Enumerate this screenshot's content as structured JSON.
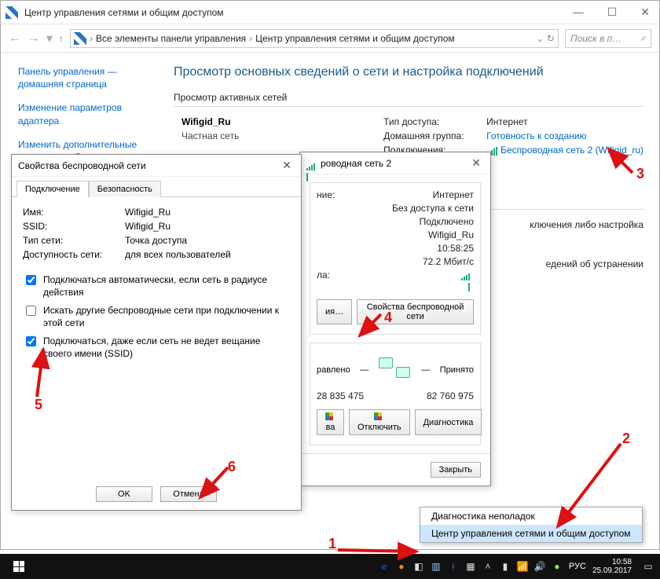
{
  "window": {
    "title": "Центр управления сетями и общим доступом",
    "breadcrumb": {
      "parent": "Все элементы панели управления",
      "current": "Центр управления сетями и общим доступом"
    },
    "search_placeholder": "Поиск в п…"
  },
  "sidebar": {
    "home": "Панель управления — домашняя страница",
    "adapter": "Изменение параметров адаптера",
    "sharing": "Изменить дополнительные параметры общего доступа"
  },
  "main": {
    "header": "Просмотр основных сведений о сети и настройка подключений",
    "active_label": "Просмотр активных сетей",
    "network_name": "Wifigid_Ru",
    "network_type": "Частная сеть",
    "access_type_k": "Тип доступа:",
    "access_type_v": "Интернет",
    "homegroup_k": "Домашняя группа:",
    "homegroup_v": "Готовность к созданию",
    "connections_k": "Подключения:",
    "connections_v": "Беспроводная сеть 2 (Wifigid_ru)",
    "extra1": "ключения либо настройка",
    "extra2": "едений об устранении"
  },
  "status": {
    "title": "роводная сеть 2",
    "section": "ние:",
    "iptype_v": "Интернет",
    "ip6_v": "Без доступа к сети",
    "state_v": "Подключено",
    "ssid_v": "Wifigid_Ru",
    "dur_v": "10:58:25",
    "speed_v": "72.2 Мбит/с",
    "sig_k": "ла:",
    "details_btn": "ия…",
    "props_btn": "Свойства беспроводной сети",
    "activity_k": "равлено",
    "activity_r": "Принято",
    "sent": "28 835 475",
    "recv": "82 760 975",
    "props2": "ва",
    "disable": "Отключить",
    "diag": "Диагностика",
    "close": "Закрыть"
  },
  "props": {
    "title": "Свойства беспроводной сети",
    "tab1": "Подключение",
    "tab2": "Безопасность",
    "name_k": "Имя:",
    "name_v": "Wifigid_Ru",
    "ssid_k": "SSID:",
    "ssid_v": "Wifigid_Ru",
    "ntype_k": "Тип сети:",
    "ntype_v": "Точка доступа",
    "avail_k": "Доступность сети:",
    "avail_v": "для всех пользователей",
    "cb1": "Подключаться автоматически, если сеть в радиусе действия",
    "cb2": "Искать другие беспроводные сети при подключении к этой сети",
    "cb3": "Подключаться, даже если сеть не ведет вещание своего имени (SSID)",
    "ok": "OK",
    "cancel": "Отмена"
  },
  "ctxmenu": {
    "item1": "Диагностика неполадок",
    "item2": "Центр управления сетями и общим доступом"
  },
  "taskbar": {
    "lang": "РУС",
    "time": "10:58",
    "date": "25.09.2017"
  },
  "ann": {
    "n1": "1",
    "n2": "2",
    "n3": "3",
    "n4": "4",
    "n5": "5",
    "n6": "6"
  }
}
